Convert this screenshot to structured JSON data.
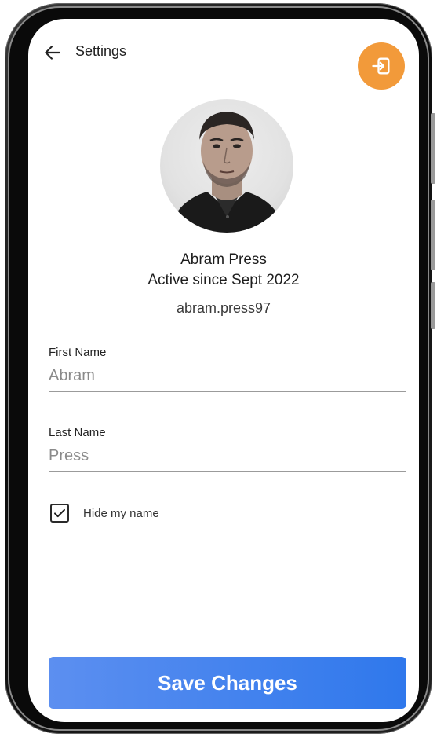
{
  "header": {
    "title": "Settings",
    "back_icon": "arrow-left-icon",
    "exit_icon": "sign-out-icon",
    "exit_color": "#f29a3a"
  },
  "profile": {
    "name": "Abram Press",
    "active_since": "Active since Sept 2022",
    "username": "abram.press97"
  },
  "form": {
    "first_name": {
      "label": "First Name",
      "value": "Abram"
    },
    "last_name": {
      "label": "Last Name",
      "value": "Press"
    },
    "hide_name": {
      "label": "Hide my name",
      "checked": true
    }
  },
  "actions": {
    "save_label": "Save Changes",
    "save_color": "#2f78ec"
  }
}
